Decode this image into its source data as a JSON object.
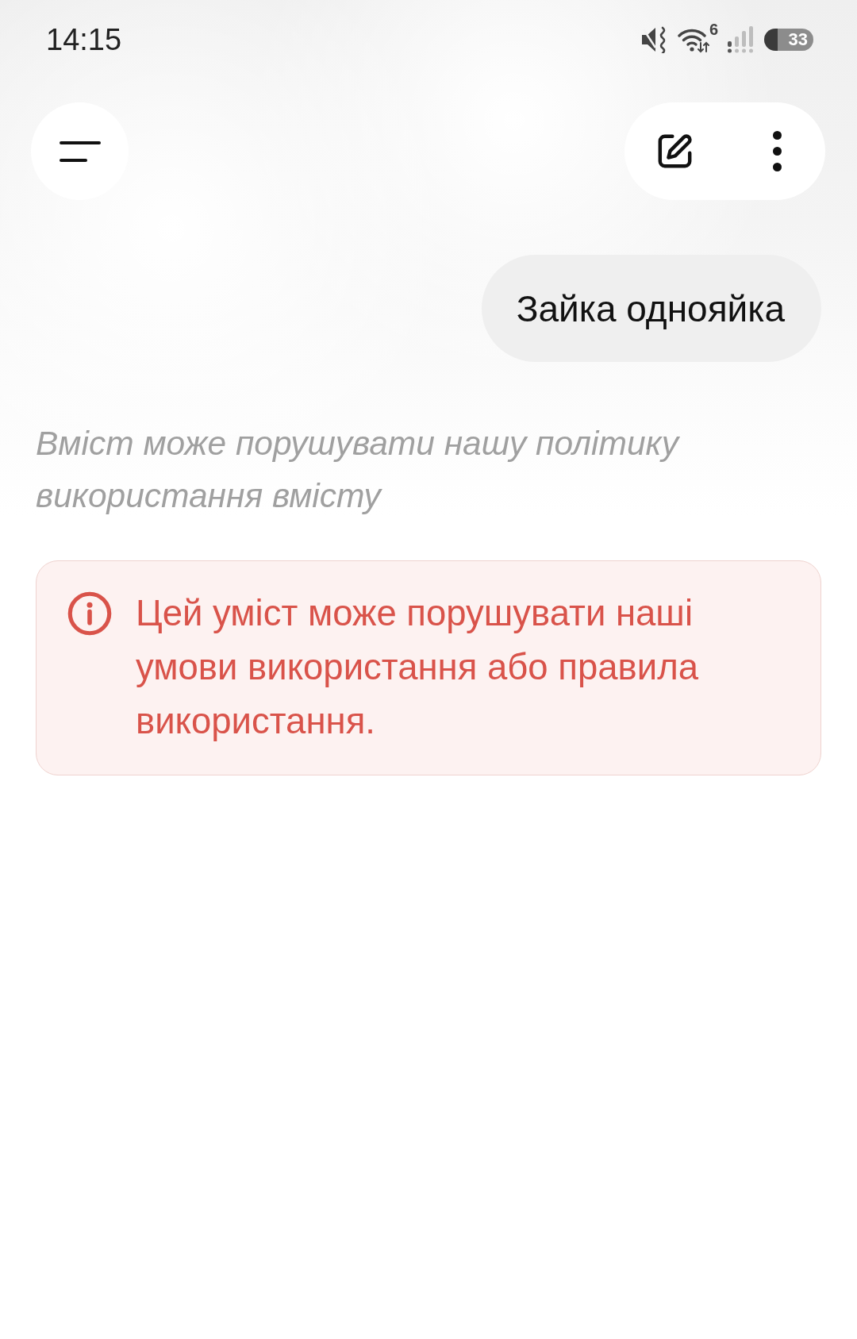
{
  "status_bar": {
    "time": "14:15",
    "wifi_badge": "6",
    "battery": "33"
  },
  "conversation": {
    "user_message": "Зайка однояйка",
    "policy_notice": "Вміст може порушувати нашу політику використання вмісту",
    "warning": "Цей уміст може порушувати наші умови використання або правила використання."
  }
}
